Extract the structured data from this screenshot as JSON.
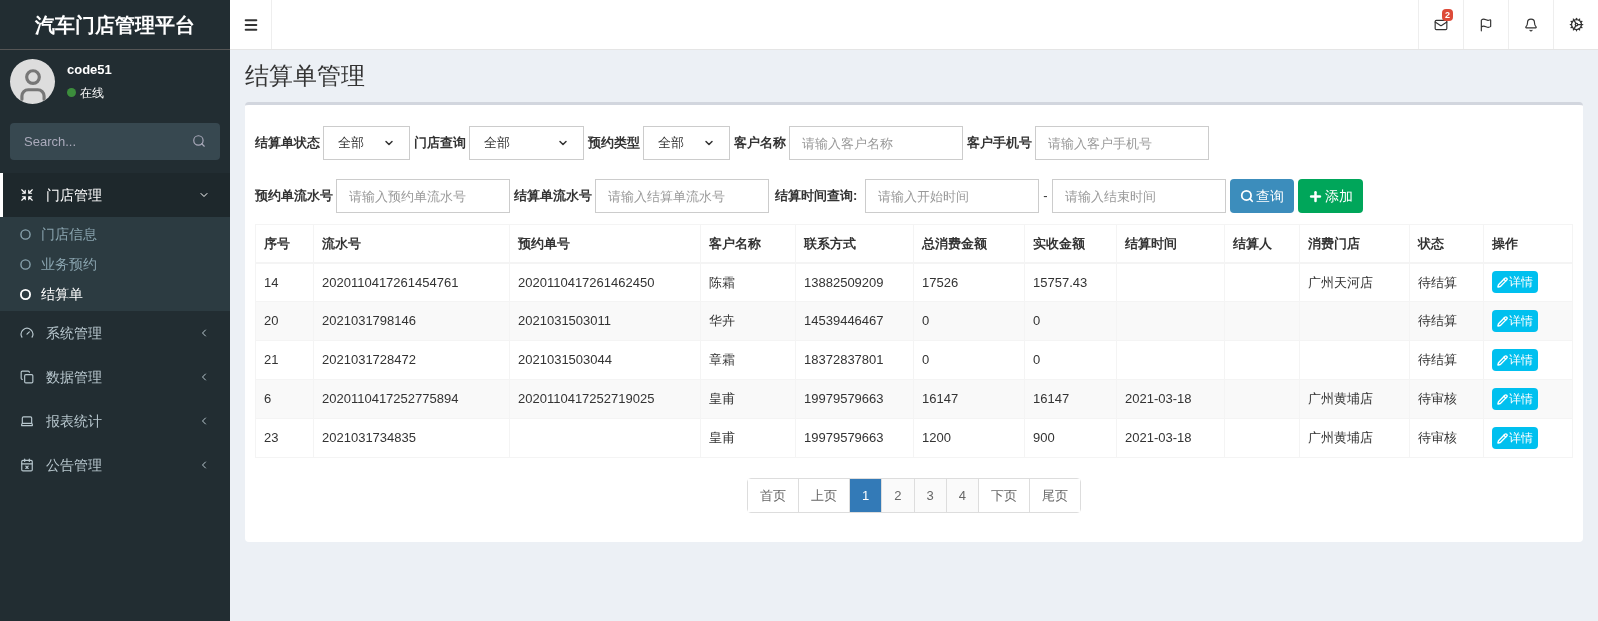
{
  "brand": "汽车门店管理平台",
  "user": {
    "name": "code51",
    "status": "在线",
    "online": true
  },
  "search": {
    "placeholder": "Search..."
  },
  "menu": [
    {
      "label": "门店管理",
      "expanded": true,
      "children": [
        {
          "label": "门店信息",
          "selected": false
        },
        {
          "label": "业务预约",
          "selected": false
        },
        {
          "label": "结算单",
          "selected": true
        }
      ]
    },
    {
      "label": "系统管理",
      "expanded": false
    },
    {
      "label": "数据管理",
      "expanded": false
    },
    {
      "label": "报表统计",
      "expanded": false
    },
    {
      "label": "公告管理",
      "expanded": false
    }
  ],
  "header": {
    "mail_badge": "2"
  },
  "page_title": "结算单管理",
  "filters": [
    {
      "label": "结算单状态",
      "kind": "select",
      "value": "全部"
    },
    {
      "label": "门店查询",
      "kind": "select",
      "value": "全部"
    },
    {
      "label": "预约类型",
      "kind": "select",
      "value": "全部"
    },
    {
      "label": "客户名称",
      "kind": "input",
      "placeholder": "请输入客户名称"
    },
    {
      "label": "客户手机号",
      "kind": "input",
      "placeholder": "请输入客户手机号"
    }
  ],
  "filters2": [
    {
      "label": "预约单流水号",
      "placeholder": "请输入预约单流水号"
    },
    {
      "label": "结算单流水号",
      "placeholder": "请输入结算单流水号"
    }
  ],
  "time_query": {
    "label": "结算时间查询:",
    "start_placeholder": "请输入开始时间",
    "separator": "-",
    "end_placeholder": "请输入结束时间"
  },
  "actions": [
    {
      "label": "查询",
      "kind": "search"
    },
    {
      "label": "添加",
      "kind": "add"
    }
  ],
  "table": {
    "columns": [
      "序号",
      "流水号",
      "预约单号",
      "客户名称",
      "联系方式",
      "总消费金额",
      "实收金额",
      "结算时间",
      "结算人",
      "消费门店",
      "状态",
      "操作"
    ],
    "rows": [
      {
        "cells": [
          "14",
          "2020110417261454761",
          "2020110417261462450",
          "陈霜",
          "13882509209",
          "17526",
          "15757.43",
          "",
          "",
          "广州天河店",
          "待结算"
        ],
        "action": "详情"
      },
      {
        "cells": [
          "20",
          "2021031798146",
          "2021031503011",
          "华卉",
          "14539446467",
          "0",
          "0",
          "",
          "",
          "",
          "待结算"
        ],
        "action": "详情"
      },
      {
        "cells": [
          "21",
          "2021031728472",
          "2021031503044",
          "章霜",
          "18372837801",
          "0",
          "0",
          "",
          "",
          "",
          "待结算"
        ],
        "action": "详情"
      },
      {
        "cells": [
          "6",
          "2020110417252775894",
          "2020110417252719025",
          "皇甫",
          "19979579663",
          "16147",
          "16147",
          "2021-03-18",
          "",
          "广州黄埔店",
          "待审核"
        ],
        "action": "详情"
      },
      {
        "cells": [
          "23",
          "2021031734835",
          "",
          "皇甫",
          "19979579663",
          "1200",
          "900",
          "2021-03-18",
          "",
          "广州黄埔店",
          "待审核"
        ],
        "action": "详情"
      }
    ]
  },
  "pagination": [
    {
      "label": "首页",
      "selected": false
    },
    {
      "label": "上页",
      "selected": false
    },
    {
      "label": "1",
      "selected": true
    },
    {
      "label": "2",
      "selected": false
    },
    {
      "label": "3",
      "selected": false
    },
    {
      "label": "4",
      "selected": false
    },
    {
      "label": "下页",
      "selected": false
    },
    {
      "label": "尾页",
      "selected": false
    }
  ]
}
